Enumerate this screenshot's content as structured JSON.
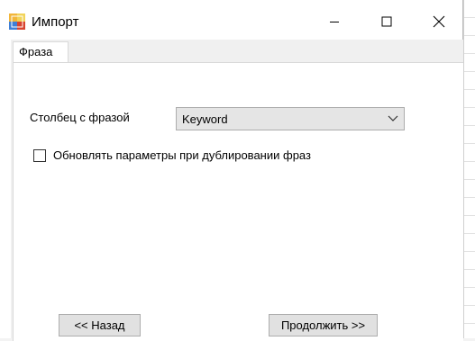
{
  "window": {
    "title": "Импорт",
    "icon": "import-app-icon",
    "controls": [
      "minimize-icon",
      "maximize-icon",
      "close-icon"
    ]
  },
  "tabs": [
    {
      "label": "Фраза",
      "selected": true
    }
  ],
  "form": {
    "column_label": "Столбец с фразой",
    "column_value": "Keyword",
    "update_checkbox_label": "Обновлять параметры при дублировании фраз",
    "update_checkbox_checked": false
  },
  "buttons": {
    "back_label": "<< Назад",
    "next_label": "Продолжить >>"
  }
}
